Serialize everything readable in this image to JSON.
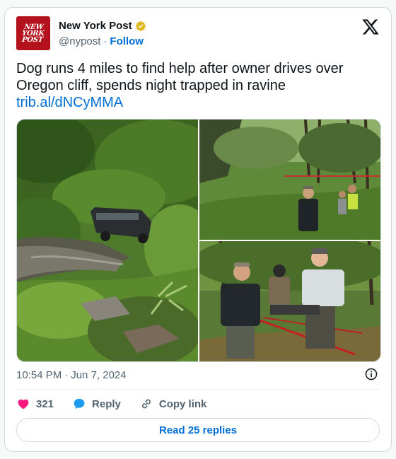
{
  "author": {
    "avatar_text": [
      "NEW",
      "YORK",
      "POST"
    ],
    "display_name": "New York Post",
    "handle": "@nypost",
    "separator": "·",
    "follow_label": "Follow",
    "verified_badge": "gold-verified-badge-icon"
  },
  "platform_logo": "x-logo-icon",
  "tweet": {
    "text": "Dog runs 4 miles to find help after owner drives over Oregon cliff, spends night trapped in ravine",
    "link": "trib.al/dNCyMMA"
  },
  "media": {
    "photos": [
      "SUV crashed in creek surrounded by greenery",
      "Rescuers hauling a rope up a wooded hillside",
      "Rescuers carrying a stretcher through the forest"
    ]
  },
  "meta": {
    "time": "10:54 PM",
    "separator": "·",
    "date": "Jun 7, 2024"
  },
  "actions": {
    "like_count": "321",
    "reply_label": "Reply",
    "copy_label": "Copy link"
  },
  "read_replies_label": "Read 25 replies",
  "colors": {
    "accent": "#006fd6",
    "like": "#f91880",
    "reply": "#1d9bf0",
    "brand_red": "#b3121c"
  }
}
